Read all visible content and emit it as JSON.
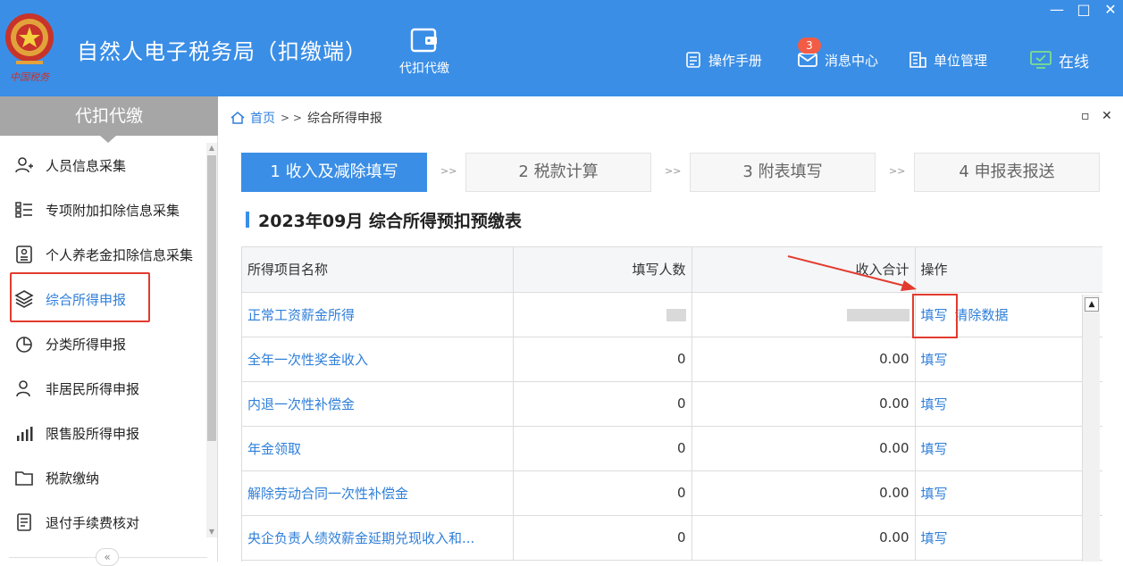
{
  "header": {
    "app_title": "自然人电子税务局（扣缴端）",
    "emblem_text": "中国税务",
    "nav_tab_label": "代扣代缴",
    "tools": {
      "manual": "操作手册",
      "messages": "消息中心",
      "message_count": "3",
      "unit_mgmt": "单位管理",
      "online": "在线"
    },
    "window_controls": {
      "minimize": "—",
      "maximize": "□",
      "close": "✕"
    }
  },
  "sidebar": {
    "title": "代扣代缴",
    "items": [
      {
        "label": "人员信息采集",
        "icon": "person-add-icon"
      },
      {
        "label": "专项附加扣除信息采集",
        "icon": "list-icon"
      },
      {
        "label": "个人养老金扣除信息采集",
        "icon": "id-card-icon"
      },
      {
        "label": "综合所得申报",
        "icon": "layers-icon",
        "active": true
      },
      {
        "label": "分类所得申报",
        "icon": "pie-chart-icon"
      },
      {
        "label": "非居民所得申报",
        "icon": "person-icon"
      },
      {
        "label": "限售股所得申报",
        "icon": "bar-chart-icon"
      },
      {
        "label": "税款缴纳",
        "icon": "folder-icon"
      },
      {
        "label": "退付手续费核对",
        "icon": "document-icon"
      }
    ],
    "collapse_label": "«"
  },
  "breadcrumb": {
    "home": "首页",
    "separator": "> >",
    "current": "综合所得申报"
  },
  "panel_controls": {
    "restore": "▫",
    "close": "✕"
  },
  "steps": [
    {
      "label": "1 收入及减除填写",
      "active": true
    },
    {
      "label": "2 税款计算",
      "active": false
    },
    {
      "label": "3 附表填写",
      "active": false
    },
    {
      "label": "4 申报表报送",
      "active": false
    }
  ],
  "step_separator": ">>",
  "section_title": "2023年09月  综合所得预扣预缴表",
  "table": {
    "columns": [
      "所得项目名称",
      "填写人数",
      "收入合计",
      "操作"
    ],
    "rows": [
      {
        "name": "正常工资薪金所得",
        "count": "",
        "income": "",
        "ops": [
          "填写",
          "清除数据"
        ]
      },
      {
        "name": "全年一次性奖金收入",
        "count": "0",
        "income": "0.00",
        "ops": [
          "填写"
        ]
      },
      {
        "name": "内退一次性补偿金",
        "count": "0",
        "income": "0.00",
        "ops": [
          "填写"
        ]
      },
      {
        "name": "年金领取",
        "count": "0",
        "income": "0.00",
        "ops": [
          "填写"
        ]
      },
      {
        "name": "解除劳动合同一次性补偿金",
        "count": "0",
        "income": "0.00",
        "ops": [
          "填写"
        ]
      },
      {
        "name": "央企负责人绩效薪金延期兑现收入和...",
        "count": "0",
        "income": "0.00",
        "ops": [
          "填写"
        ]
      }
    ]
  },
  "colors": {
    "primary": "#3a8ee6",
    "link": "#2f7fd9",
    "highlight": "#e23b2e",
    "sidebar_head": "#a6a6a6"
  }
}
